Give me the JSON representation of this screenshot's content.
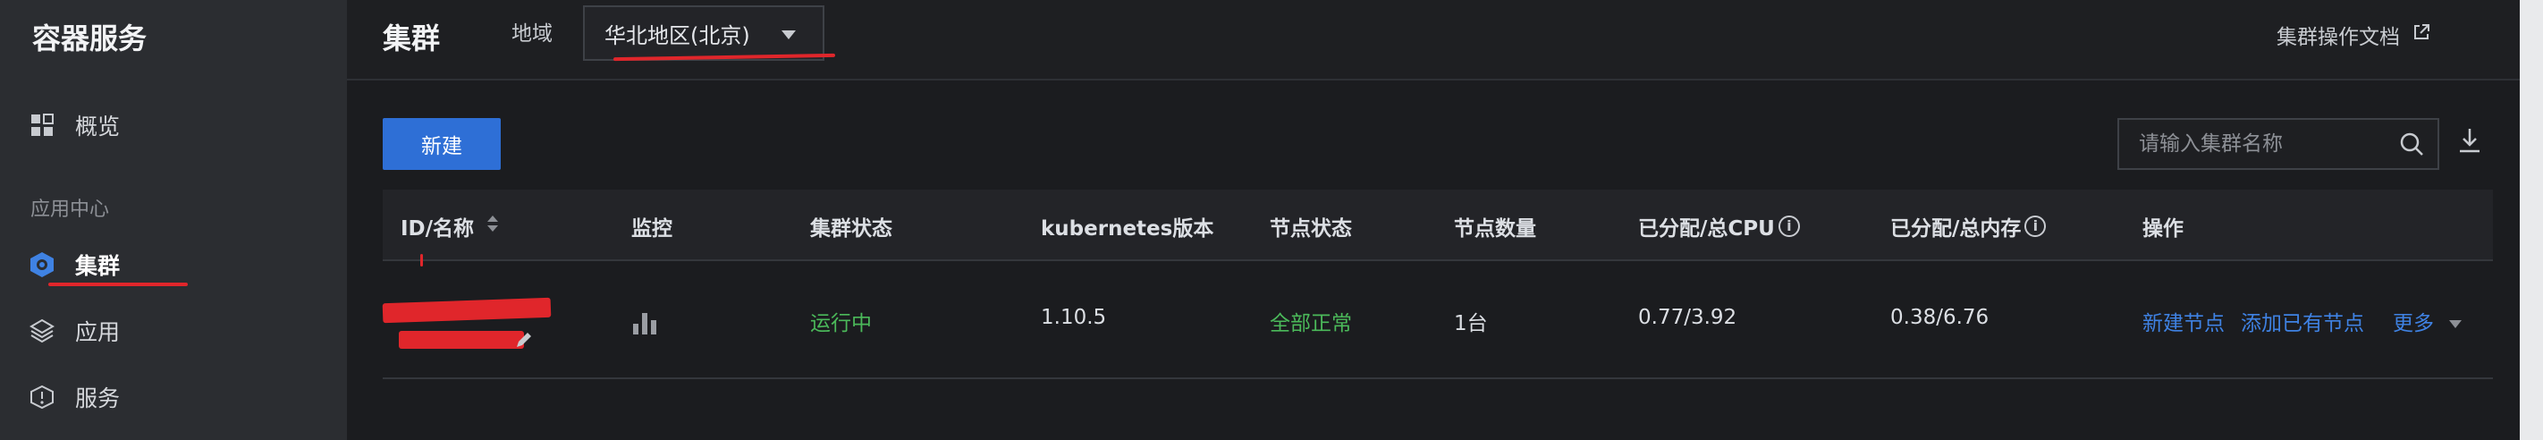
{
  "sidebar": {
    "brand": "容器服务",
    "items": [
      {
        "label": "概览",
        "icon": "grid-icon"
      },
      {
        "label": "集群",
        "icon": "cluster-icon"
      },
      {
        "label": "应用",
        "icon": "layers-icon"
      },
      {
        "label": "服务",
        "icon": "service-icon"
      }
    ],
    "group_label": "应用中心"
  },
  "header": {
    "title": "集群",
    "region_label": "地域",
    "region_value": "华北地区(北京)",
    "doc_link": "集群操作文档"
  },
  "toolbar": {
    "new_label": "新建",
    "search_placeholder": "请输入集群名称"
  },
  "table": {
    "columns": [
      "ID/名称",
      "监控",
      "集群状态",
      "kubernetes版本",
      "节点状态",
      "节点数量",
      "已分配/总CPU",
      "已分配/总内存",
      "操作"
    ],
    "rows": [
      {
        "status": "运行中",
        "version": "1.10.5",
        "node_status": "全部正常",
        "node_count": "1台",
        "cpu": "0.77/3.92",
        "memory": "0.38/6.76",
        "actions": [
          "新建节点",
          "添加已有节点",
          "更多"
        ]
      }
    ]
  },
  "colors": {
    "accent": "#2e6fd6",
    "link": "#3f82e3",
    "status_ok": "#4bb95a",
    "annotation": "#e0262b"
  }
}
